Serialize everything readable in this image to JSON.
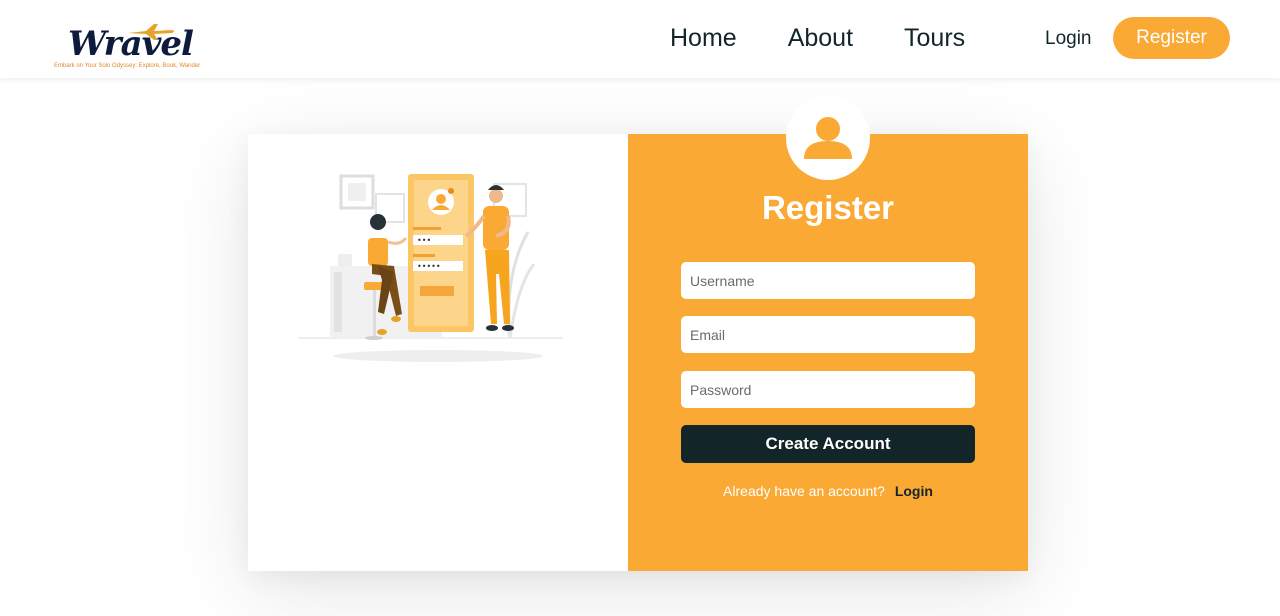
{
  "brand": {
    "name": "Wravel",
    "tagline": "Embark on Your Solo Odyssey: Explore, Book, Wander"
  },
  "nav": {
    "links": [
      "Home",
      "About",
      "Tours"
    ],
    "login_label": "Login",
    "register_label": "Register"
  },
  "form": {
    "title": "Register",
    "username_placeholder": "Username",
    "email_placeholder": "Email",
    "password_placeholder": "Password",
    "submit_label": "Create Account",
    "already_text": "Already have an account?",
    "login_link": "Login"
  },
  "colors": {
    "accent": "#faa935",
    "dark": "#12262a",
    "brand_navy": "#0f1b3d"
  },
  "icons": {
    "avatar": "user-icon",
    "logo_plane": "airplane-icon"
  }
}
